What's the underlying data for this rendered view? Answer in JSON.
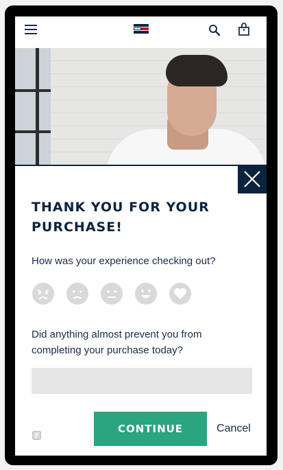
{
  "header": {
    "menu_icon": "hamburger-menu-icon",
    "logo": "tommy-hilfiger-flag-logo",
    "search_icon": "search-icon",
    "bag_icon": "shopping-bag-icon"
  },
  "modal": {
    "title": "THANK YOU FOR YOUR PURCHASE!",
    "question_experience": "How was your experience checking out?",
    "ratings": [
      "very-dissatisfied",
      "dissatisfied",
      "neutral",
      "satisfied",
      "love"
    ],
    "question_prevent": "Did anything almost prevent you from completing your purchase today?",
    "answer_value": "",
    "continue_label": "CONTINUE",
    "cancel_label": "Cancel"
  },
  "colors": {
    "navy": "#0c2340",
    "accent_green": "#2aa57e",
    "rating_grey": "#d9d9d9",
    "input_bg": "#e6e6e6"
  }
}
